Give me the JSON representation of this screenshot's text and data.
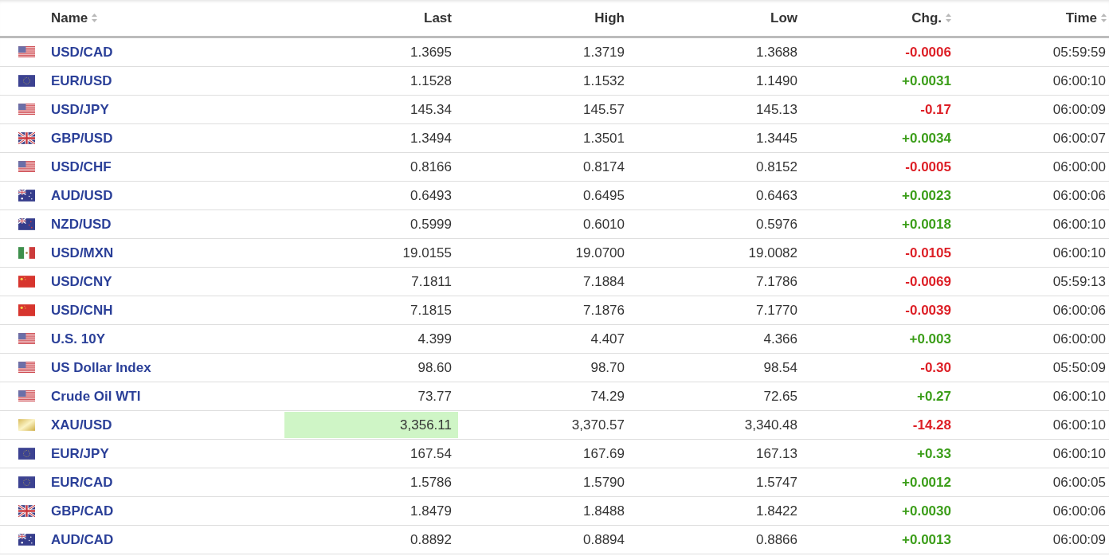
{
  "columns": [
    {
      "label": "Name",
      "sortable": true
    },
    {
      "label": "Last",
      "sortable": false
    },
    {
      "label": "High",
      "sortable": false
    },
    {
      "label": "Low",
      "sortable": false
    },
    {
      "label": "Chg.",
      "sortable": true
    },
    {
      "label": "Time",
      "sortable": true
    }
  ],
  "rows": [
    {
      "kind": "us",
      "name": "USD/CAD",
      "last": "1.3695",
      "last_highlighted": false,
      "high": "1.3719",
      "low": "1.3688",
      "change": "-0.0006",
      "color": "#dd1f26",
      "time": "05:59:59"
    },
    {
      "kind": "eu",
      "name": "EUR/USD",
      "last": "1.1528",
      "last_highlighted": false,
      "high": "1.1532",
      "low": "1.1490",
      "change": "+0.0031",
      "color": "#3c9e1a",
      "time": "06:00:10"
    },
    {
      "kind": "us",
      "name": "USD/JPY",
      "last": "145.34",
      "last_highlighted": false,
      "high": "145.57",
      "low": "145.13",
      "change": "-0.17",
      "color": "#dd1f26",
      "time": "06:00:09"
    },
    {
      "kind": "gb",
      "name": "GBP/USD",
      "last": "1.3494",
      "last_highlighted": false,
      "high": "1.3501",
      "low": "1.3445",
      "change": "+0.0034",
      "color": "#3c9e1a",
      "time": "06:00:07"
    },
    {
      "kind": "us",
      "name": "USD/CHF",
      "last": "0.8166",
      "last_highlighted": false,
      "high": "0.8174",
      "low": "0.8152",
      "change": "-0.0005",
      "color": "#dd1f26",
      "time": "06:00:00"
    },
    {
      "kind": "au",
      "name": "AUD/USD",
      "last": "0.6493",
      "last_highlighted": false,
      "high": "0.6495",
      "low": "0.6463",
      "change": "+0.0023",
      "color": "#3c9e1a",
      "time": "06:00:06"
    },
    {
      "kind": "nz",
      "name": "NZD/USD",
      "last": "0.5999",
      "last_highlighted": false,
      "high": "0.6010",
      "low": "0.5976",
      "change": "+0.0018",
      "color": "#3c9e1a",
      "time": "06:00:10"
    },
    {
      "kind": "mx",
      "name": "USD/MXN",
      "last": "19.0155",
      "last_highlighted": false,
      "high": "19.0700",
      "low": "19.0082",
      "change": "-0.0105",
      "color": "#dd1f26",
      "time": "06:00:10"
    },
    {
      "kind": "cn",
      "name": "USD/CNY",
      "last": "7.1811",
      "last_highlighted": false,
      "high": "7.1884",
      "low": "7.1786",
      "change": "-0.0069",
      "color": "#dd1f26",
      "time": "05:59:13"
    },
    {
      "kind": "cn",
      "name": "USD/CNH",
      "last": "7.1815",
      "last_highlighted": false,
      "high": "7.1876",
      "low": "7.1770",
      "change": "-0.0039",
      "color": "#dd1f26",
      "time": "06:00:06"
    },
    {
      "kind": "us",
      "name": "U.S. 10Y",
      "last": "4.399",
      "last_highlighted": false,
      "high": "4.407",
      "low": "4.366",
      "change": "+0.003",
      "color": "#3c9e1a",
      "time": "06:00:00"
    },
    {
      "kind": "us",
      "name": "US Dollar Index",
      "last": "98.60",
      "last_highlighted": false,
      "high": "98.70",
      "low": "98.54",
      "change": "-0.30",
      "color": "#dd1f26",
      "time": "05:50:09"
    },
    {
      "kind": "us",
      "name": "Crude Oil WTI",
      "last": "73.77",
      "last_highlighted": false,
      "high": "74.29",
      "low": "72.65",
      "change": "+0.27",
      "color": "#3c9e1a",
      "time": "06:00:10"
    },
    {
      "kind": "gold",
      "name": "XAU/USD",
      "last": "3,356.11",
      "last_highlighted": true,
      "high": "3,370.57",
      "low": "3,340.48",
      "change": "-14.28",
      "color": "#dd1f26",
      "time": "06:00:10"
    },
    {
      "kind": "eu",
      "name": "EUR/JPY",
      "last": "167.54",
      "last_highlighted": false,
      "high": "167.69",
      "low": "167.13",
      "change": "+0.33",
      "color": "#3c9e1a",
      "time": "06:00:10"
    },
    {
      "kind": "eu",
      "name": "EUR/CAD",
      "last": "1.5786",
      "last_highlighted": false,
      "high": "1.5790",
      "low": "1.5747",
      "change": "+0.0012",
      "color": "#3c9e1a",
      "time": "06:00:05"
    },
    {
      "kind": "gb",
      "name": "GBP/CAD",
      "last": "1.8479",
      "last_highlighted": false,
      "high": "1.8488",
      "low": "1.8422",
      "change": "+0.0030",
      "color": "#3c9e1a",
      "time": "06:00:06"
    },
    {
      "kind": "au",
      "name": "AUD/CAD",
      "last": "0.8892",
      "last_highlighted": false,
      "high": "0.8894",
      "low": "0.8866",
      "change": "+0.0013",
      "color": "#3c9e1a",
      "time": "06:00:09"
    }
  ]
}
